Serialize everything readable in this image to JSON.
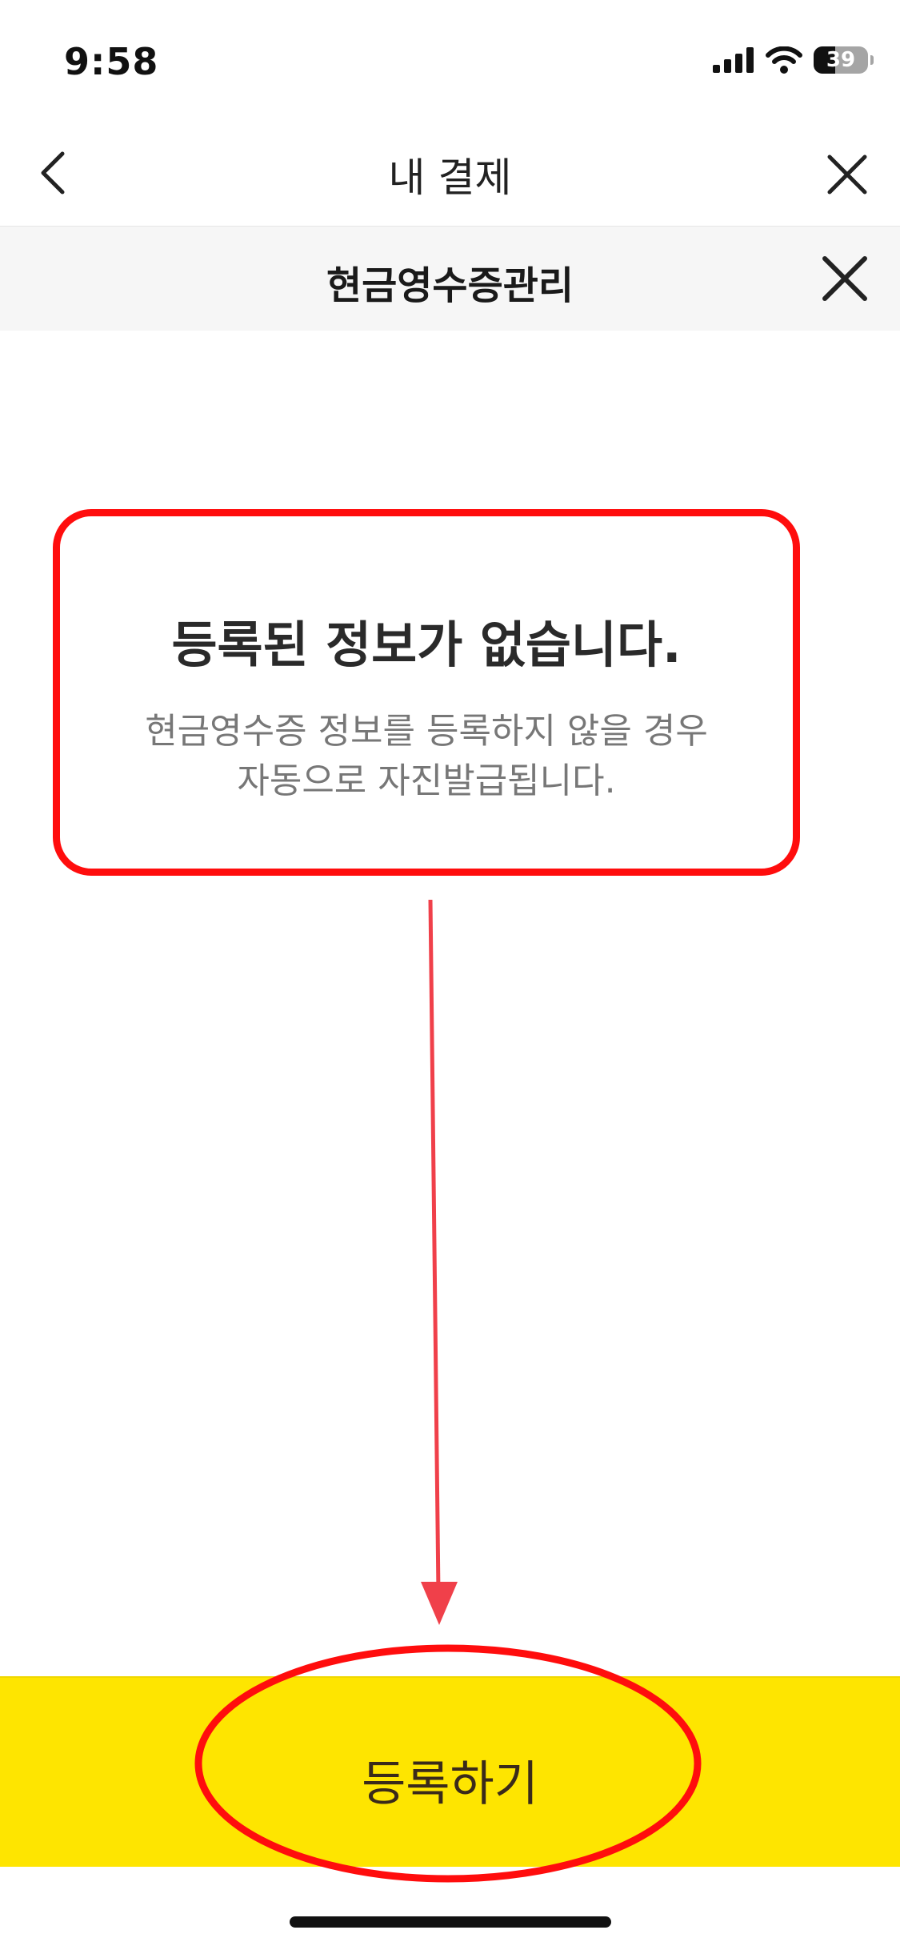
{
  "status_bar": {
    "time": "9:58",
    "battery_percent": "39"
  },
  "nav_header": {
    "title": "내 결제"
  },
  "sheet": {
    "title": "현금영수증관리"
  },
  "empty_state": {
    "title": "등록된 정보가 없습니다.",
    "description_line1": "현금영수증 정보를 등록하지 않을 경우",
    "description_line2": "자동으로 자진발급됩니다."
  },
  "primary_action": {
    "label": "등록하기"
  },
  "colors": {
    "accent_yellow": "#fee500",
    "annotation_red": "#ff0d0d"
  }
}
